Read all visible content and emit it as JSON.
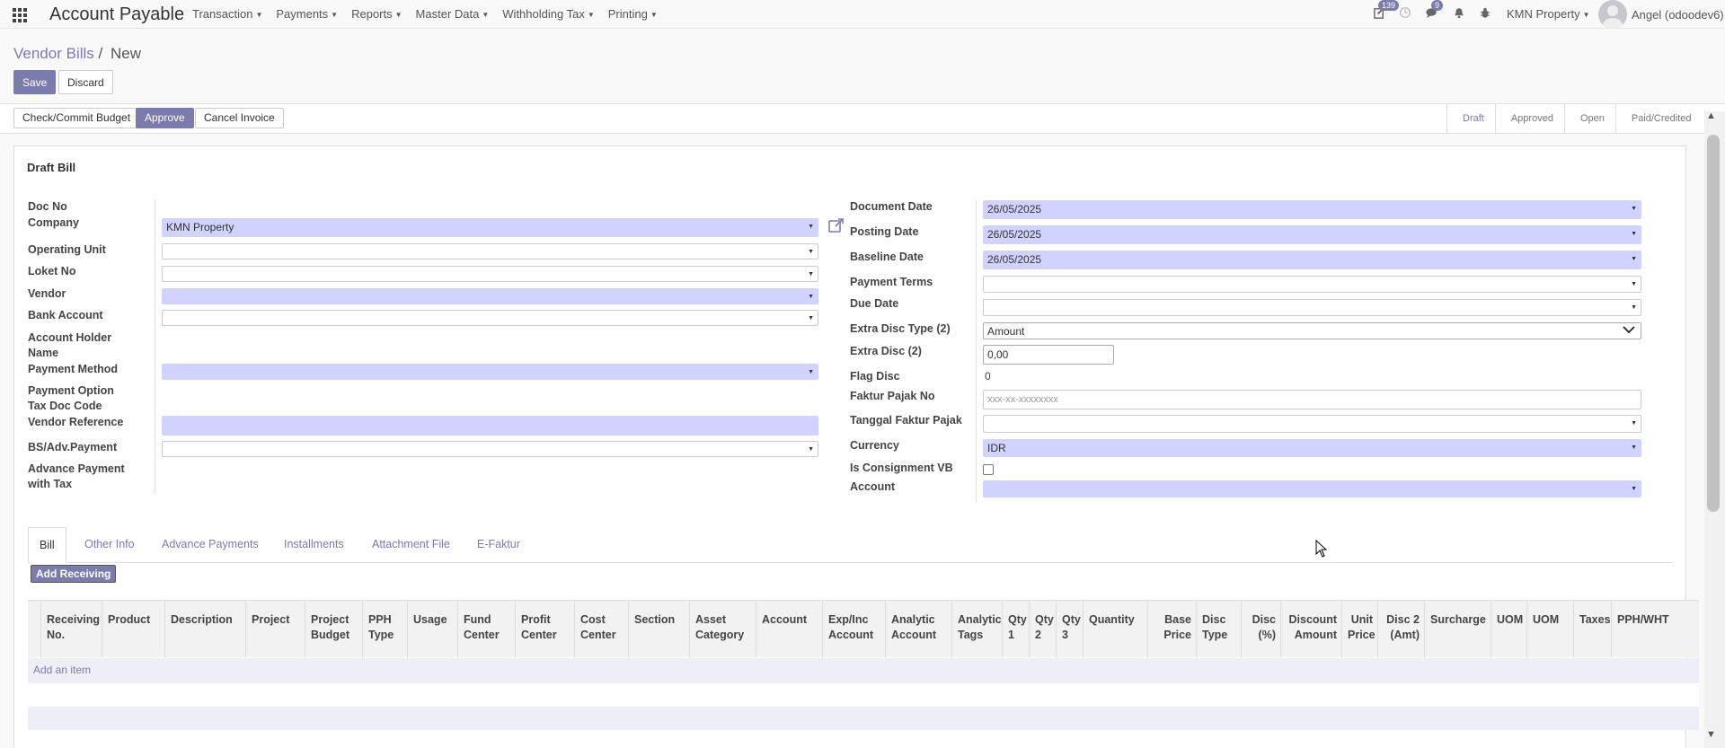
{
  "app": {
    "title": "Account Payable",
    "menu": [
      "Transaction",
      "Payments",
      "Reports",
      "Master Data",
      "Withholding Tax",
      "Printing"
    ],
    "activity_badge": "139",
    "messages_badge": "9",
    "company": "KMN Property",
    "user": "Angel (odoodev6)"
  },
  "breadcrumb": {
    "parent": "Vendor Bills",
    "sep": "/",
    "current": "New"
  },
  "buttons": {
    "save": "Save",
    "discard": "Discard",
    "check_budget": "Check/Commit Budget",
    "approve": "Approve",
    "cancel_invoice": "Cancel Invoice",
    "add_receiving": "Add Receiving"
  },
  "statusbar": [
    "Draft",
    "Approved",
    "Open",
    "Paid/Credited"
  ],
  "status_active": "Draft",
  "form": {
    "title": "Draft Bill",
    "left": {
      "doc_no": "Doc No",
      "company": "Company",
      "company_value": "KMN Property",
      "operating_unit": "Operating Unit",
      "loket_no": "Loket No",
      "vendor": "Vendor",
      "bank_account": "Bank Account",
      "account_holder_1": "Account Holder",
      "account_holder_2": "Name",
      "payment_method": "Payment Method",
      "payment_option": "Payment Option",
      "tax_doc_code": "Tax Doc Code",
      "vendor_reference": "Vendor Reference",
      "bs_adv_payment": "BS/Adv.Payment",
      "adv_payment_tax_1": "Advance Payment",
      "adv_payment_tax_2": "with Tax"
    },
    "right": {
      "document_date": "Document Date",
      "document_date_value": "26/05/2025",
      "posting_date": "Posting Date",
      "posting_date_value": "26/05/2025",
      "baseline_date": "Baseline Date",
      "baseline_date_value": "26/05/2025",
      "payment_terms": "Payment Terms",
      "due_date": "Due Date",
      "extra_disc_type": "Extra Disc Type (2)",
      "extra_disc_type_value": "Amount",
      "extra_disc": "Extra Disc (2)",
      "extra_disc_value": "0,00",
      "flag_disc": "Flag Disc",
      "flag_disc_value": "0",
      "faktur_pajak_no": "Faktur Pajak No",
      "faktur_pajak_placeholder": "xxx-xx-xxxxxxxx",
      "tanggal_faktur": "Tanggal Faktur Pajak",
      "currency": "Currency",
      "currency_value": "IDR",
      "is_consignment": "Is Consignment VB",
      "account": "Account"
    }
  },
  "tabs": [
    "Bill",
    "Other Info",
    "Advance Payments",
    "Installments",
    "Attachment File",
    "E-Faktur"
  ],
  "table": {
    "columns": [
      [
        "Receiving",
        "No."
      ],
      [
        "Product"
      ],
      [
        "Description"
      ],
      [
        "Project"
      ],
      [
        "Project",
        "Budget"
      ],
      [
        "PPH",
        "Type"
      ],
      [
        "Usage"
      ],
      [
        "Fund",
        "Center"
      ],
      [
        "Profit",
        "Center"
      ],
      [
        "Cost",
        "Center"
      ],
      [
        "Section"
      ],
      [
        "Asset",
        "Category"
      ],
      [
        "Account"
      ],
      [
        "Exp/Inc",
        "Account"
      ],
      [
        "Analytic",
        "Account"
      ],
      [
        "Analytic",
        "Tags"
      ],
      [
        "Qty",
        "1"
      ],
      [
        "Qty",
        "2"
      ],
      [
        "Qty",
        "3"
      ],
      [
        "Quantity"
      ],
      [
        "Base",
        "Price"
      ],
      [
        "Disc",
        "Type"
      ],
      [
        "Disc",
        "(%)"
      ],
      [
        "Discount",
        "Amount"
      ],
      [
        "Unit",
        "Price"
      ],
      [
        "Disc 2",
        "(Amt)"
      ],
      [
        "Surcharge"
      ],
      [
        "UOM"
      ],
      [
        "UOM"
      ],
      [
        "Taxes"
      ],
      [
        "PPH/WHT"
      ]
    ],
    "add_item": "Add an item"
  },
  "icons": {
    "apps": "apps-grid-icon",
    "activity": "activity-icon",
    "clock": "clock-icon",
    "chat": "chat-icon",
    "bell": "bell-icon",
    "debug": "bug-icon",
    "external": "external-link-icon"
  },
  "colors": {
    "primary": "#7c7bad",
    "required_field": "#d2d2ff"
  }
}
